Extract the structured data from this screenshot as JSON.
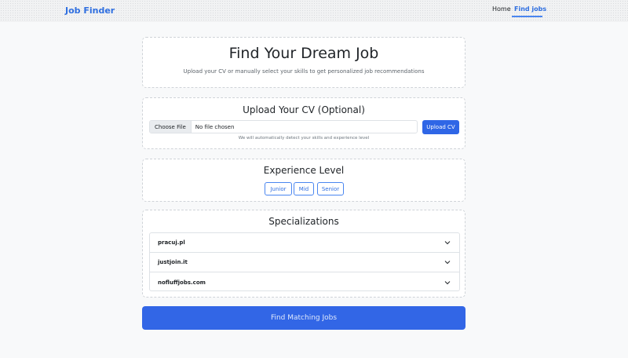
{
  "navbar": {
    "brand": "Job Finder",
    "links": [
      {
        "label": "Home"
      },
      {
        "label": "Find jobs"
      }
    ]
  },
  "hero": {
    "title": "Find Your Dream Job",
    "subtitle": "Upload your CV or manually select your skills to get personalized job recommendations"
  },
  "upload": {
    "title": "Upload Your CV (Optional)",
    "choose_label": "Choose File",
    "file_status": "No file chosen",
    "upload_label": "Upload CV",
    "hint": "We will automatically detect your skills and experience level"
  },
  "experience": {
    "title": "Experience Level",
    "levels": [
      "Junior",
      "Mid",
      "Senior"
    ]
  },
  "specializations": {
    "title": "Specializations",
    "items": [
      "pracuj.pl",
      "justjoin.it",
      "nofluffjobs.com"
    ]
  },
  "submit": {
    "label": "Find Matching Jobs"
  },
  "colors": {
    "primary": "#2f66e6",
    "brand": "#2f6fe0",
    "background": "#f8f9fa"
  }
}
